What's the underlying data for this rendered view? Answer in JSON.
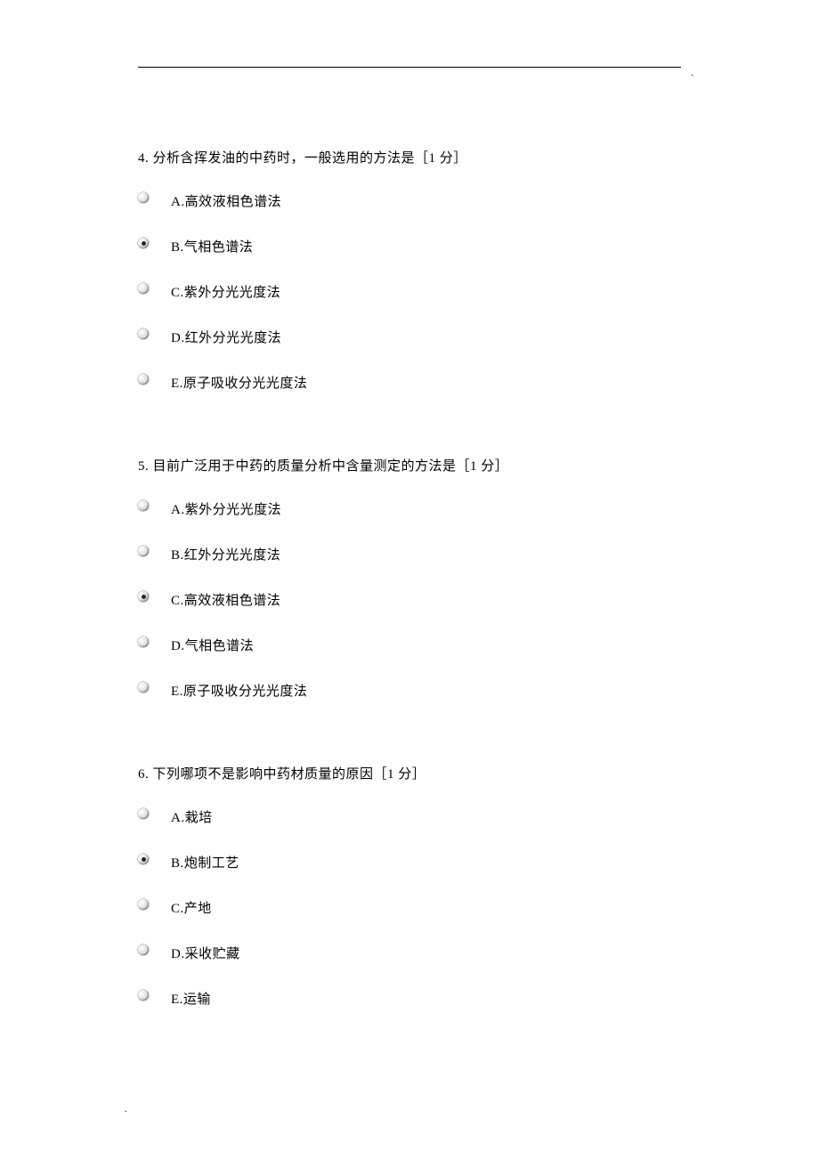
{
  "questions": [
    {
      "number": "4.",
      "text": "分析含挥发油的中药时，一般选用的方法是［1 分］",
      "options": [
        {
          "label": "A.高效液相色谱法",
          "selected": false
        },
        {
          "label": "B.气相色谱法",
          "selected": true
        },
        {
          "label": "C.紫外分光光度法",
          "selected": false
        },
        {
          "label": "D.红外分光光度法",
          "selected": false
        },
        {
          "label": "E.原子吸收分光光度法",
          "selected": false
        }
      ]
    },
    {
      "number": "5.",
      "text": "目前广泛用于中药的质量分析中含量测定的方法是［1 分］",
      "options": [
        {
          "label": "A.紫外分光光度法",
          "selected": false
        },
        {
          "label": "B.红外分光光度法",
          "selected": false
        },
        {
          "label": "C.高效液相色谱法",
          "selected": true
        },
        {
          "label": "D.气相色谱法",
          "selected": false
        },
        {
          "label": "E.原子吸收分光光度法",
          "selected": false
        }
      ]
    },
    {
      "number": "6.",
      "text": "下列哪项不是影响中药材质量的原因［1 分］",
      "options": [
        {
          "label": "A.栽培",
          "selected": false
        },
        {
          "label": "B.炮制工艺",
          "selected": true
        },
        {
          "label": "C.产地",
          "selected": false
        },
        {
          "label": "D.采收贮藏",
          "selected": false
        },
        {
          "label": "E.运输",
          "selected": false
        }
      ]
    }
  ],
  "headerDot": ".",
  "footerDot": "."
}
